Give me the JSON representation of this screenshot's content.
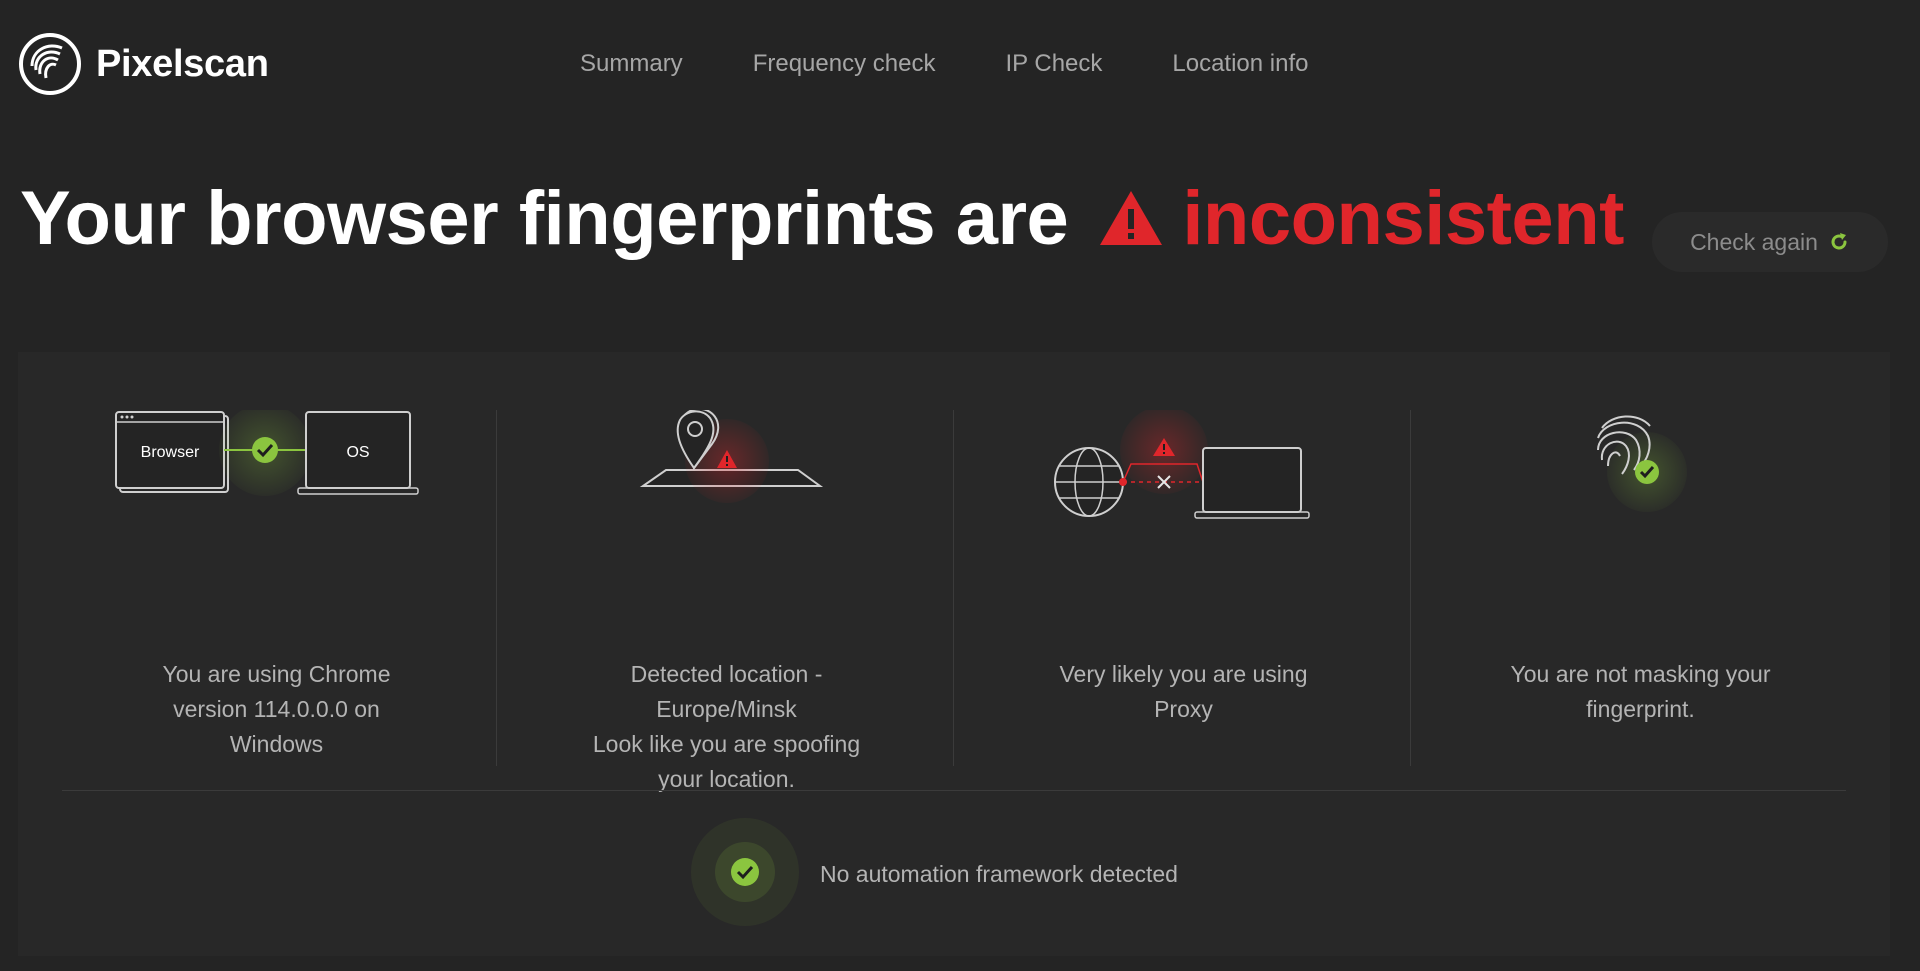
{
  "app": {
    "logo_text": "Pixelscan"
  },
  "nav": {
    "items": [
      "Summary",
      "Frequency check",
      "IP Check",
      "Location info"
    ]
  },
  "hero": {
    "title": "Your browser fingerprints are",
    "status": "inconsistent",
    "status_color": "#e0262b"
  },
  "check_again": {
    "label": "Check again",
    "icon": "refresh-icon",
    "icon_color": "#8bc53f"
  },
  "cards": [
    {
      "illustration": "browser-os-illustration",
      "browser_label": "Browser",
      "os_label": "OS",
      "status": "ok",
      "text": "You are using Chrome\nversion 114.0.0.0 on\nWindows"
    },
    {
      "illustration": "location-pin-illustration",
      "status": "warning",
      "text": "Detected location -\nEurope/Minsk\nLook like you are spoofing\nyour location."
    },
    {
      "illustration": "proxy-globe-illustration",
      "status": "warning",
      "text": "Very likely you are using\nProxy"
    },
    {
      "illustration": "fingerprint-illustration",
      "status": "ok",
      "text": "You are not masking your\nfingerprint."
    }
  ],
  "automation": {
    "status": "ok",
    "text": "No automation framework detected"
  },
  "colors": {
    "ok": "#8bc53f",
    "warning": "#e0262b",
    "background": "#242424",
    "panel": "#282828"
  }
}
